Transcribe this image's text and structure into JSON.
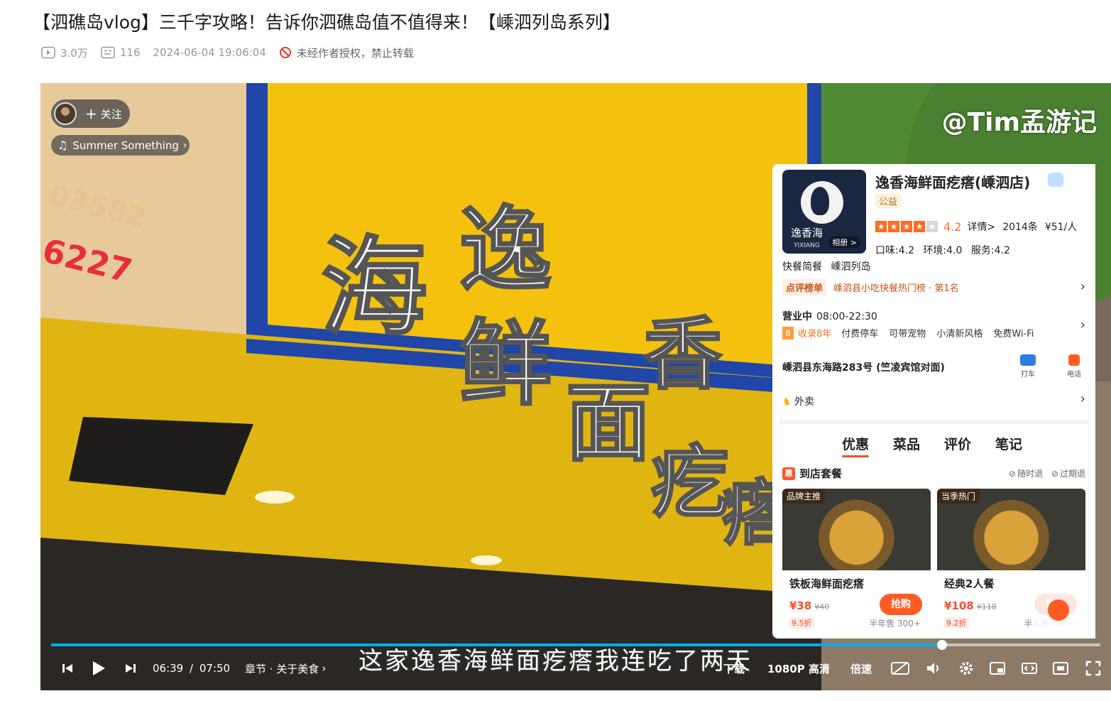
{
  "video": {
    "title": "【泗礁岛vlog】三千字攻略！告诉你泗礁岛值不值得来！【嵊泗列岛系列】",
    "views": "3.0万",
    "danmaku": "116",
    "date": "2024-06-04 19:06:04",
    "copyright": "未经作者授权，禁止转载"
  },
  "overlay": {
    "follow_label": "关注",
    "music": "Summer Something",
    "watermark": "@Tim孟游记"
  },
  "shop": {
    "name": "逸香海鲜面疙瘩(嵊泗店)",
    "tag": "公益",
    "logo_text": "逸香海",
    "logo_en": "YIXIANG",
    "album": "相册 >",
    "stars": 4,
    "rating": "4.2",
    "detail": "详情>",
    "reviews": "2014条",
    "price": "¥51/人",
    "sub_scores": [
      "口味:4.2",
      "环境:4.0",
      "服务:4.2"
    ],
    "categories": [
      "快餐简餐",
      "嵊泗列岛"
    ],
    "rank_key": "点评榜单",
    "rank_value": "嵊泗县小吃快餐热门榜 · 第1名",
    "status": "营业中",
    "hours": "08:00-22:30",
    "years_badge": "8",
    "years": "收录8年",
    "features": [
      "付费停车",
      "可带宠物",
      "小清新风格",
      "免费Wi-Fi"
    ],
    "address": "嵊泗县东海路283号 (竺凌宾馆对面)",
    "taxi": "打车",
    "phone": "电话",
    "delivery": "外卖",
    "tabs": [
      "优惠",
      "菜品",
      "评价",
      "笔记"
    ],
    "section_icon": "惠",
    "section": "到店套餐",
    "policy": [
      "随时退",
      "过期退"
    ],
    "deals": [
      {
        "label": "品牌主推",
        "name": "铁板海鲜面疙瘩",
        "price": "¥38",
        "orig": "¥40",
        "buy": "抢购",
        "discount": "9.5折",
        "sold": "半年售 300+"
      },
      {
        "label": "当季热门",
        "name": "经典2人餐",
        "price": "¥108",
        "orig": "¥118",
        "buy": "抢购",
        "discount": "9.2折",
        "sold": "半年售 300+"
      }
    ]
  },
  "subtitle": "这家逸香海鲜面疙瘩我连吃了两天",
  "controls": {
    "current_time": "06:39",
    "separator": "/",
    "duration": "07:50",
    "chapter": "章节 · 关于美食",
    "download": "下载",
    "quality": "1080P 高清",
    "speed": "倍速",
    "progress": 0.8489
  }
}
